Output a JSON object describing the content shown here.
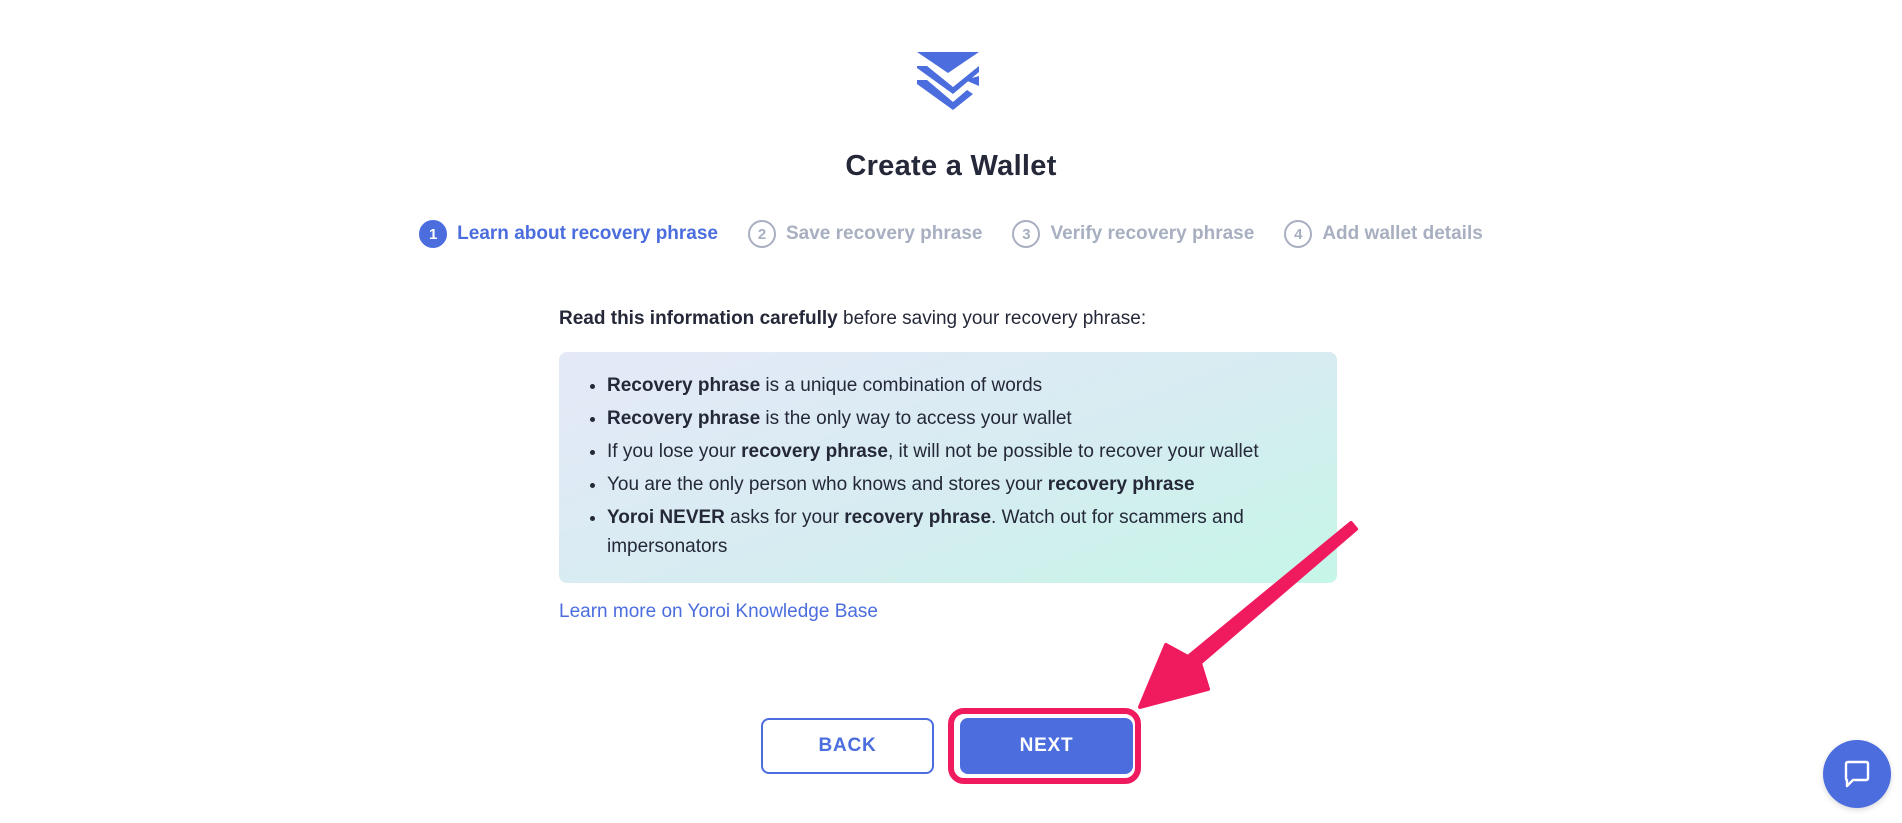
{
  "page": {
    "title": "Create a Wallet"
  },
  "stepper": {
    "steps": [
      {
        "number": "1",
        "label": "Learn about recovery phrase",
        "active": true
      },
      {
        "number": "2",
        "label": "Save recovery phrase",
        "active": false
      },
      {
        "number": "3",
        "label": "Verify recovery phrase",
        "active": false
      },
      {
        "number": "4",
        "label": "Add wallet details",
        "active": false
      }
    ]
  },
  "intro": {
    "bold": "Read this information carefully",
    "rest": " before saving your recovery phrase:"
  },
  "info_items": {
    "item1": {
      "b1": "Recovery phrase",
      "t1": " is a unique combination of words"
    },
    "item2": {
      "b1": "Recovery phrase",
      "t1": " is the only way to access your wallet"
    },
    "item3": {
      "t0": "If you lose your ",
      "b1": "recovery phrase",
      "t1": ", it will not be possible to recover your wallet"
    },
    "item4": {
      "t0": "You are the only person who knows and stores your ",
      "b1": "recovery phrase"
    },
    "item5": {
      "b0": "Yoroi NEVER",
      "t0": " asks for your ",
      "b1": "recovery phrase",
      "t1": ". Watch out for scammers and impersonators"
    }
  },
  "links": {
    "knowledge_base": "Learn more on Yoroi Knowledge Base"
  },
  "buttons": {
    "back_label": "BACK",
    "next_label": "NEXT"
  },
  "icons": {
    "logo": "yoroi-logo-icon",
    "chat": "chat-bubble-icon",
    "annotation_arrow": "pointer-arrow-annotation"
  },
  "colors": {
    "accent": "#4b6dde",
    "text": "#242838",
    "muted": "#a7afc0",
    "annotation": "#f01a5e"
  }
}
